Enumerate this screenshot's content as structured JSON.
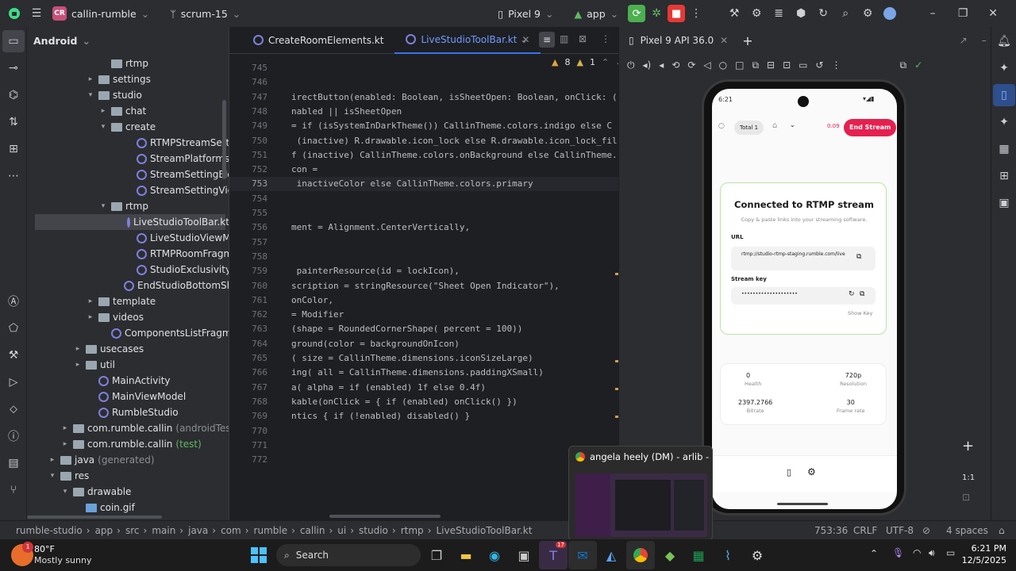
{
  "titlebar": {
    "project": "callin-rumble",
    "project_initials": "CR",
    "branch": "scrum-15",
    "device": "Pixel 9",
    "run_config": "app"
  },
  "project_panel": {
    "title": "Android",
    "tree": [
      {
        "label": "rtmp",
        "arrow": "",
        "icon": "folder"
      },
      {
        "label": "settings",
        "arrow": "▸",
        "icon": "folder"
      },
      {
        "label": "studio",
        "arrow": "▾",
        "icon": "folder"
      },
      {
        "label": "chat",
        "arrow": "▸",
        "icon": "folder"
      },
      {
        "label": "create",
        "arrow": "▾",
        "icon": "folder"
      },
      {
        "label": "RTMPStreamSettingsB",
        "arrow": "",
        "icon": "kt"
      },
      {
        "label": "StreamPlatformsBotto",
        "arrow": "",
        "icon": "kt"
      },
      {
        "label": "StreamSettingElement",
        "arrow": "",
        "icon": "kt"
      },
      {
        "label": "StreamSettingViewMo",
        "arrow": "",
        "icon": "kt"
      },
      {
        "label": "rtmp",
        "arrow": "▾",
        "icon": "folder"
      },
      {
        "label": "LiveStudioToolBar.kt",
        "arrow": "",
        "icon": "kt"
      },
      {
        "label": "LiveStudioViewModel",
        "arrow": "",
        "icon": "kt"
      },
      {
        "label": "RTMPRoomFragment.k",
        "arrow": "",
        "icon": "kt"
      },
      {
        "label": "StudioExclusivityBotto",
        "arrow": "",
        "icon": "kt"
      },
      {
        "label": "EndStudioBottomSheet.k",
        "arrow": "",
        "icon": "kt"
      },
      {
        "label": "template",
        "arrow": "▸",
        "icon": "folder"
      },
      {
        "label": "videos",
        "arrow": "▸",
        "icon": "folder"
      },
      {
        "label": "ComponentsListFragment.kt",
        "arrow": "",
        "icon": "kt"
      },
      {
        "label": "usecases",
        "arrow": "▸",
        "icon": "folder"
      },
      {
        "label": "util",
        "arrow": "▸",
        "icon": "folder"
      },
      {
        "label": "MainActivity",
        "arrow": "",
        "icon": "kt"
      },
      {
        "label": "MainViewModel",
        "arrow": "",
        "icon": "kt"
      },
      {
        "label": "RumbleStudio",
        "arrow": "",
        "icon": "kt"
      },
      {
        "label": "com.rumble.callin",
        "suffix": "(androidTest)",
        "arrow": "▸",
        "icon": "folder"
      },
      {
        "label": "com.rumble.callin",
        "suffix": "(test)",
        "arrow": "▸",
        "icon": "folder"
      },
      {
        "label": "java",
        "suffix": "(generated)",
        "arrow": "▸",
        "icon": "folder"
      },
      {
        "label": "res",
        "arrow": "▾",
        "icon": "folder"
      },
      {
        "label": "drawable",
        "arrow": "▾",
        "icon": "folder"
      },
      {
        "label": "coin.gif",
        "arrow": "",
        "icon": "file"
      }
    ]
  },
  "editor": {
    "tabs": [
      {
        "label": "CreateRoomElements.kt",
        "active": false
      },
      {
        "label": "LiveStudioToolBar.kt",
        "active": true
      }
    ],
    "inspection_warnings": "8",
    "inspection_weak": "1",
    "lines": [
      {
        "n": "745",
        "code": ""
      },
      {
        "n": "746",
        "code": ""
      },
      {
        "n": "747",
        "code": "irectButton(enabled: Boolean, isSheetOpen: Boolean, onClick: ("
      },
      {
        "n": "748",
        "code": "nabled || isSheetOpen"
      },
      {
        "n": "749",
        "code": "= if (isSystemInDarkTheme()) CallinTheme.colors.indigo else C"
      },
      {
        "n": "750",
        "code": " (inactive) R.drawable.icon_lock else R.drawable.icon_lock_fil"
      },
      {
        "n": "751",
        "code": "f (inactive) CallinTheme.colors.onBackground else CallinTheme."
      },
      {
        "n": "752",
        "code": "con ="
      },
      {
        "n": "753",
        "code": " inactiveColor else CallinTheme.colors.primary"
      },
      {
        "n": "754",
        "code": ""
      },
      {
        "n": "755",
        "code": ""
      },
      {
        "n": "756",
        "code": "ment = Alignment.CenterVertically,"
      },
      {
        "n": "757",
        "code": ""
      },
      {
        "n": "758",
        "code": ""
      },
      {
        "n": "759",
        "code": " painterResource(id = lockIcon),"
      },
      {
        "n": "760",
        "code": "scription = stringResource(\"Sheet Open Indicator\"),"
      },
      {
        "n": "761",
        "code": "onColor,"
      },
      {
        "n": "762",
        "code": "= Modifier"
      },
      {
        "n": "763",
        "code": "(shape = RoundedCornerShape( percent = 100))"
      },
      {
        "n": "764",
        "code": "ground(color = backgroundOnIcon)"
      },
      {
        "n": "765",
        "code": "( size = CallinTheme.dimensions.iconSizeLarge)"
      },
      {
        "n": "766",
        "code": "ing( all = CallinTheme.dimensions.paddingXSmall)"
      },
      {
        "n": "767",
        "code": "a( alpha = if (enabled) 1f else 0.4f)"
      },
      {
        "n": "768",
        "code": "kable(onClick = { if (enabled) onClick() })"
      },
      {
        "n": "769",
        "code": "ntics { if (!enabled) disabled() }"
      },
      {
        "n": "770",
        "code": ""
      },
      {
        "n": "771",
        "code": ""
      },
      {
        "n": "772",
        "code": ""
      }
    ]
  },
  "emulator": {
    "tab_label": "Pixel 9 API 36.0",
    "phone": {
      "time": "6:21",
      "total_label": "Total 1",
      "timer": "0:09",
      "end_stream": "End Stream",
      "connected_title": "Connected to RTMP stream",
      "connected_sub": "Copy & paste links into your streaming software.",
      "url_label": "URL",
      "url_value": "rtmp://studio-rtmp-staging.rumble.com/live",
      "key_label": "Stream key",
      "key_value": "••••••••••••••••••••",
      "show_key": "Show Key",
      "stats": [
        {
          "value": "0",
          "label": "Health"
        },
        {
          "value": "720p",
          "label": "Resolution"
        },
        {
          "value": "2397.2766",
          "label": "Bitrate"
        },
        {
          "value": "30",
          "label": "Frame rate"
        }
      ]
    },
    "zoom_label": "1:1"
  },
  "statusbar": {
    "breadcrumbs": [
      "rumble-studio",
      "app",
      "src",
      "main",
      "java",
      "com",
      "rumble",
      "callin",
      "ui",
      "studio",
      "rtmp",
      "LiveStudioToolBar.kt"
    ],
    "position": "753:36",
    "line_ending": "CRLF",
    "encoding": "UTF-8",
    "indent": "4 spaces"
  },
  "popup": {
    "title": "angela heely (DM) - arlib - S..."
  },
  "taskbar": {
    "temp": "80°F",
    "weather": "Mostly sunny",
    "weather_badge": "1",
    "search": "Search",
    "time": "6:21 PM",
    "date": "12/5/2025",
    "teams_badge": "17"
  },
  "colors": {
    "accent": "#3574f0",
    "end_stream": "#e5204f",
    "run_green": "#4caf50",
    "stop_red": "#e53935"
  }
}
